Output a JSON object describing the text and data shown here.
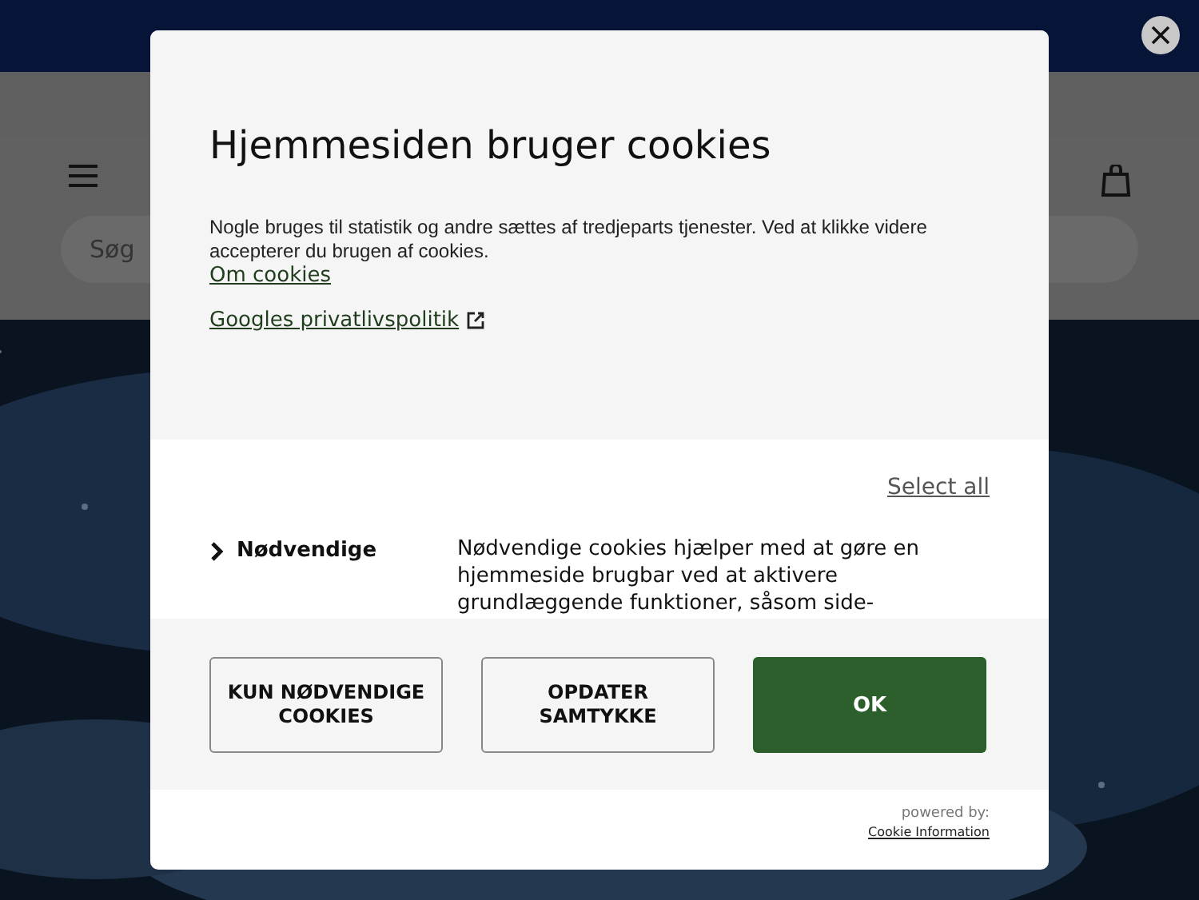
{
  "page": {
    "search": {
      "placeholder": "Søg"
    }
  },
  "dialog": {
    "title": "Hjemmesiden bruger cookies",
    "intro": "Nogle bruges til statistik og andre sættes af tredjeparts tjenester. Ved at klikke videre accepterer du brugen af cookies.",
    "links": [
      {
        "label": "Om cookies",
        "external": false
      },
      {
        "label": "Googles privatlivspolitik",
        "external": true
      }
    ],
    "select_all": "Select all",
    "categories": [
      {
        "name": "Nødvendige",
        "expanded": false,
        "description": "Nødvendige cookies hjælper med at gøre en hjemmeside brugbar ved at aktivere grundlæggende funktioner, såsom side-"
      }
    ],
    "buttons": [
      {
        "label": "KUN NØDVENDIGE COOKIES",
        "kind": "outline"
      },
      {
        "label": "OPDATER SAMTYKKE",
        "kind": "outline"
      },
      {
        "label": "OK",
        "kind": "primary"
      }
    ],
    "powered_by": "powered by:",
    "provider": "Cookie Information"
  }
}
